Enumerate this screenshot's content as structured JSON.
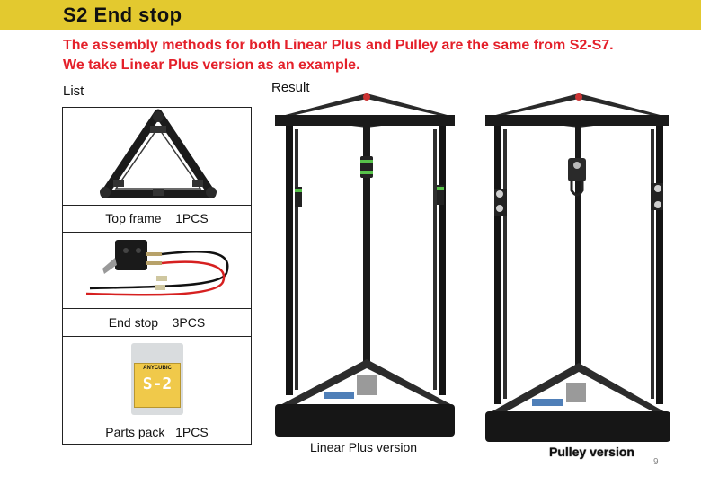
{
  "header": {
    "title": "S2   End stop",
    "bar_color": "#e3c92f"
  },
  "notice": {
    "line1": "The assembly methods for both Linear Plus and Pulley are the same from S2-S7.",
    "line2": "We take Linear Plus version as an example.",
    "color": "#e4202a"
  },
  "list": {
    "label": "List",
    "items": [
      {
        "name": "Top frame",
        "qty": "1PCS",
        "icon": "triangle-frame"
      },
      {
        "name": "End stop",
        "qty": "3PCS",
        "icon": "endstop-switch"
      },
      {
        "name": "Parts pack",
        "qty": "1PCS",
        "icon": "parts-bag"
      }
    ]
  },
  "pack_logo": {
    "brand": "ANYCUBIC",
    "code": "S-2"
  },
  "result": {
    "label": "Result",
    "linear_caption": "Linear Plus version",
    "pulley_caption": "Pulley version"
  },
  "page_number": "9"
}
